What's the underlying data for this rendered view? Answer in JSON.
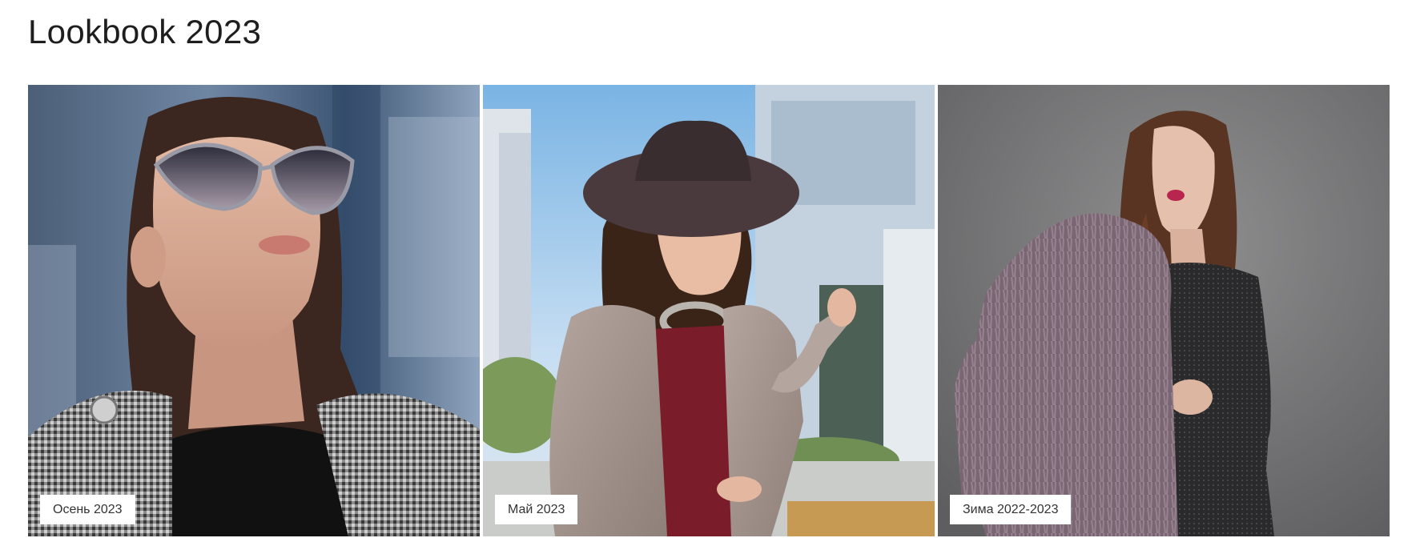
{
  "page": {
    "title": "Lookbook 2023"
  },
  "gallery": {
    "items": [
      {
        "caption": "Осень 2023",
        "icon": "sunglasses-woman-photo"
      },
      {
        "caption": "Май 2023",
        "icon": "hat-woman-photo"
      },
      {
        "caption": "Зима 2022-2023",
        "icon": "fur-coat-woman-photo"
      }
    ]
  }
}
